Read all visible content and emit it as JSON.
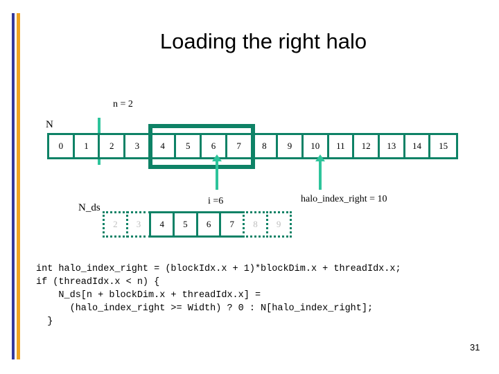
{
  "slide": {
    "title": "Loading the right halo",
    "page_number": "31",
    "accent_blue": "#33389C",
    "accent_orange": "#EFA321",
    "teal_dark": "#0E8266",
    "teal_light": "#2EC49B"
  },
  "n_array": {
    "label": "N",
    "cells": [
      "0",
      "1",
      "2",
      "3",
      "4",
      "5",
      "6",
      "7",
      "8",
      "9",
      "10",
      "11",
      "12",
      "13",
      "14",
      "15"
    ],
    "marker_label": "n = 2",
    "highlight_range": [
      4,
      7
    ],
    "arrow_i_cell": "6",
    "arrow_halo_cell": "10"
  },
  "nds_array": {
    "label": "N_ds",
    "cells": [
      {
        "value": "2",
        "style": "ghost"
      },
      {
        "value": "3",
        "style": "ghost"
      },
      {
        "value": "4",
        "style": "solid"
      },
      {
        "value": "5",
        "style": "solid"
      },
      {
        "value": "6",
        "style": "solid"
      },
      {
        "value": "7",
        "style": "solid"
      },
      {
        "value": "8",
        "style": "ghost"
      },
      {
        "value": "9",
        "style": "ghost"
      }
    ],
    "i_label": "i =6",
    "halo_index_label": "halo_index_right = 10"
  },
  "code": "int halo_index_right = (blockIdx.x + 1)*blockDim.x + threadIdx.x;\nif (threadIdx.x < n) {\n    N_ds[n + blockDim.x + threadIdx.x] =\n      (halo_index_right >= Width) ? 0 : N[halo_index_right];\n  }"
}
